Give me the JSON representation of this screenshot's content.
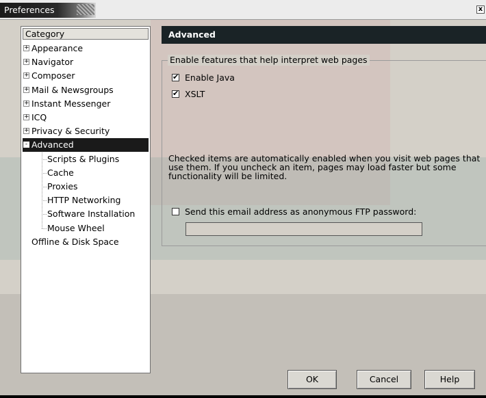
{
  "window": {
    "title": "Preferences",
    "close_label": "x"
  },
  "category": {
    "header": "Category",
    "items": [
      {
        "label": "Appearance",
        "expander": "+",
        "level": 0,
        "selected": false
      },
      {
        "label": "Navigator",
        "expander": "+",
        "level": 0,
        "selected": false
      },
      {
        "label": "Composer",
        "expander": "+",
        "level": 0,
        "selected": false
      },
      {
        "label": "Mail & Newsgroups",
        "expander": "+",
        "level": 0,
        "selected": false
      },
      {
        "label": "Instant Messenger",
        "expander": "+",
        "level": 0,
        "selected": false
      },
      {
        "label": "ICQ",
        "expander": "+",
        "level": 0,
        "selected": false
      },
      {
        "label": "Privacy & Security",
        "expander": "+",
        "level": 0,
        "selected": false
      },
      {
        "label": "Advanced",
        "expander": "-",
        "level": 0,
        "selected": true
      },
      {
        "label": "Scripts & Plugins",
        "expander": "",
        "level": 1,
        "selected": false
      },
      {
        "label": "Cache",
        "expander": "",
        "level": 1,
        "selected": false
      },
      {
        "label": "Proxies",
        "expander": "",
        "level": 1,
        "selected": false
      },
      {
        "label": "HTTP Networking",
        "expander": "",
        "level": 1,
        "selected": false
      },
      {
        "label": "Software Installation",
        "expander": "",
        "level": 1,
        "selected": false
      },
      {
        "label": "Mouse Wheel",
        "expander": "",
        "level": 1,
        "selected": false
      },
      {
        "label": "Offline & Disk Space",
        "expander": "",
        "level": 0,
        "selected": false
      }
    ]
  },
  "pane": {
    "title": "Advanced",
    "group_legend": "Enable features that help interpret web pages",
    "checkboxes": [
      {
        "label": "Enable Java",
        "checked": true
      },
      {
        "label": "XSLT",
        "checked": true
      }
    ],
    "info_text": "Checked items are automatically enabled when you visit web pages that use them. If you uncheck an item, pages may load faster but some functionality will be limited.",
    "ftp_checkbox": {
      "label": "Send this email address as anonymous FTP password:",
      "checked": false
    },
    "ftp_input_value": ""
  },
  "buttons": {
    "ok": "OK",
    "cancel": "Cancel",
    "help": "Help"
  },
  "colors": {
    "dialog_bg": "#d4d0c8",
    "header_bg": "#1a2326",
    "selected_bg": "#1a1a1a"
  }
}
